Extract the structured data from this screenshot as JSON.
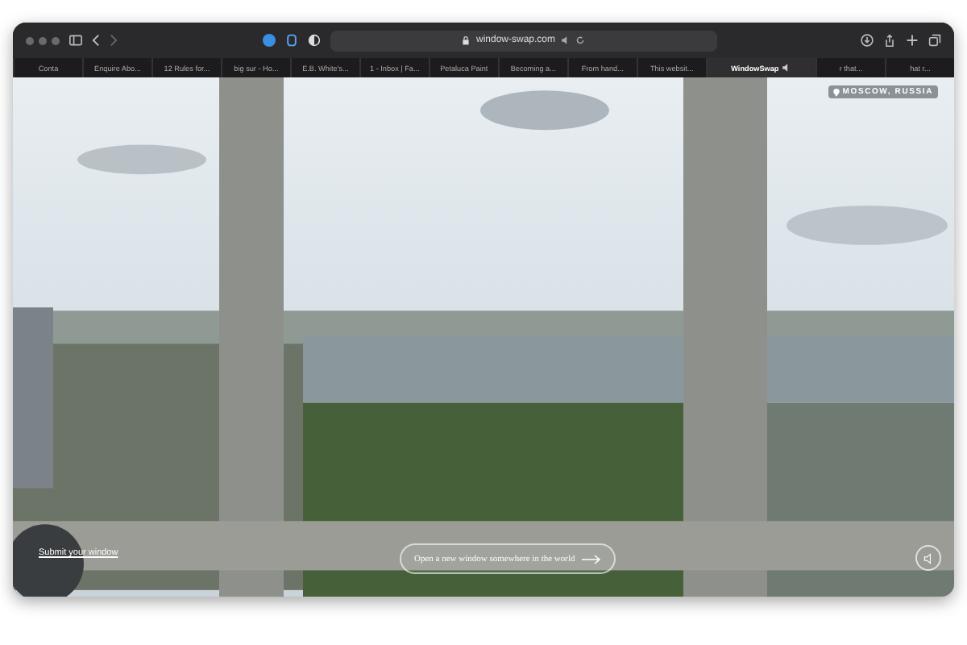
{
  "browser": {
    "address": "window-swap.com"
  },
  "tabs": [
    {
      "label": "Conta",
      "selected": false
    },
    {
      "label": "Enquire Abo...",
      "selected": false
    },
    {
      "label": "12 Rules for...",
      "selected": false
    },
    {
      "label": "big sur - Ho...",
      "selected": false
    },
    {
      "label": "E.B. White's...",
      "selected": false
    },
    {
      "label": "1 - Inbox | Fa...",
      "selected": false
    },
    {
      "label": "Petaluca Paint",
      "selected": false
    },
    {
      "label": "Becoming a...",
      "selected": false
    },
    {
      "label": "From hand...",
      "selected": false
    },
    {
      "label": "This websit...",
      "selected": false
    },
    {
      "label": "WindowSwap",
      "selected": true,
      "audio": true
    },
    {
      "label": "r that...",
      "selected": false
    },
    {
      "label": "hat r...",
      "selected": false
    }
  ],
  "view": {
    "location": "MOSCOW, RUSSIA",
    "submit_link": "Submit your window",
    "open_button": "Open a new window somewhere in the world"
  }
}
